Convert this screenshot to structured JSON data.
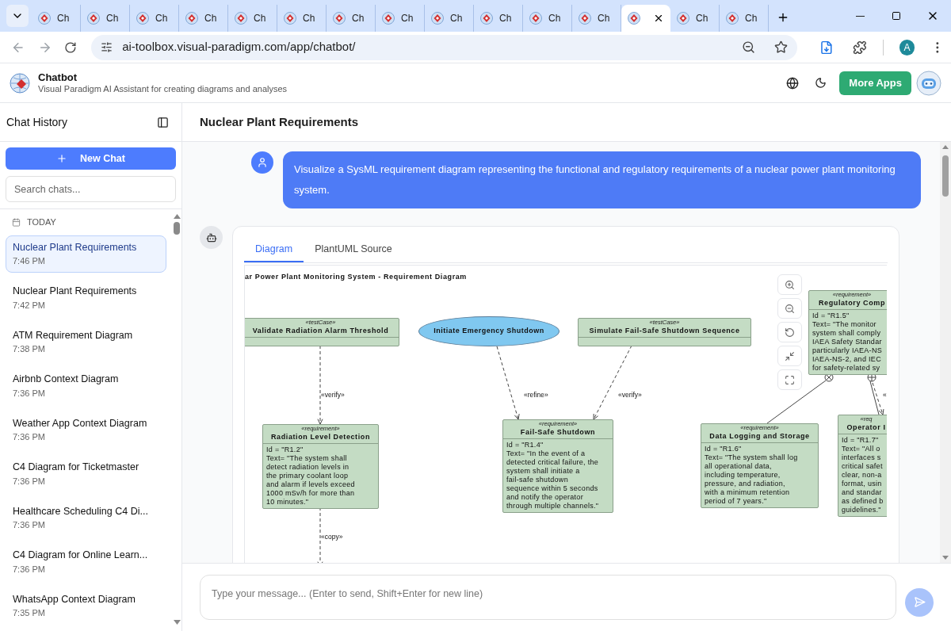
{
  "browser": {
    "tabs": [
      {
        "title": "Ch",
        "selected": false
      },
      {
        "title": "Ch",
        "selected": false
      },
      {
        "title": "Ch",
        "selected": false
      },
      {
        "title": "Ch",
        "selected": false
      },
      {
        "title": "Ch",
        "selected": false
      },
      {
        "title": "Ch",
        "selected": false
      },
      {
        "title": "Ch",
        "selected": false
      },
      {
        "title": "Ch",
        "selected": false
      },
      {
        "title": "Ch",
        "selected": false
      },
      {
        "title": "Ch",
        "selected": false
      },
      {
        "title": "Ch",
        "selected": false
      },
      {
        "title": "Ch",
        "selected": false
      },
      {
        "selected": true
      },
      {
        "title": "Ch",
        "selected": false
      },
      {
        "title": "Ch",
        "selected": false
      }
    ],
    "url": "ai-toolbox.visual-paradigm.com/app/chatbot/",
    "profile_initial": "A"
  },
  "app": {
    "title": "Chatbot",
    "subtitle": "Visual Paradigm AI Assistant for creating diagrams and analyses",
    "more_apps": "More Apps"
  },
  "sidebar": {
    "title": "Chat History",
    "new_chat": "New Chat",
    "search_placeholder": "Search chats...",
    "group": "TODAY",
    "items": [
      {
        "title": "Nuclear Plant Requirements",
        "time": "7:46 PM",
        "selected": true
      },
      {
        "title": "Nuclear Plant Requirements",
        "time": "7:42 PM",
        "selected": false
      },
      {
        "title": "ATM Requirement Diagram",
        "time": "7:38 PM",
        "selected": false
      },
      {
        "title": "Airbnb Context Diagram",
        "time": "7:36 PM",
        "selected": false
      },
      {
        "title": "Weather App Context Diagram",
        "time": "7:36 PM",
        "selected": false
      },
      {
        "title": "C4 Diagram for Ticketmaster",
        "time": "7:36 PM",
        "selected": false
      },
      {
        "title": "Healthcare Scheduling C4 Di...",
        "time": "7:36 PM",
        "selected": false
      },
      {
        "title": "C4 Diagram for Online Learn...",
        "time": "7:36 PM",
        "selected": false
      },
      {
        "title": "WhatsApp Context Diagram",
        "time": "7:35 PM",
        "selected": false
      }
    ]
  },
  "chat": {
    "title": "Nuclear Plant Requirements",
    "user_message": "Visualize a SysML requirement diagram representing the functional and regulatory requirements of a nuclear power plant monitoring system.",
    "result_tabs": [
      {
        "label": "Diagram",
        "selected": true
      },
      {
        "label": "PlantUML Source",
        "selected": false
      }
    ],
    "diagram": {
      "title": "ar Power Plant Monitoring System - Requirement Diagram",
      "nodes": [
        {
          "kind": "testcase",
          "stereotype": "«testCase»",
          "name": "Validate Radiation Alarm Threshold"
        },
        {
          "kind": "usecase",
          "name": "Initiate Emergency Shutdown"
        },
        {
          "kind": "testcase",
          "stereotype": "«testCase»",
          "name": "Simulate Fail-Safe Shutdown Sequence"
        },
        {
          "kind": "requirement",
          "stereotype": "«requirement»",
          "name": "Radiation Level Detection",
          "lines": [
            "Id = \"R1.2\"",
            "Text= \"The system shall",
            "detect radiation levels in",
            "the primary coolant loop",
            "and alarm if levels exceed",
            "1000 mSv/h for more than",
            "10 minutes.\""
          ]
        },
        {
          "kind": "requirement",
          "stereotype": "«requirement»",
          "name": "Fail-Safe Shutdown",
          "lines": [
            "Id = \"R1.4\"",
            "Text= \"In the event of a",
            "detected critical failure, the",
            "system shall initiate a",
            "fail-safe shutdown",
            "sequence within 5 seconds",
            "and notify the operator",
            "through multiple channels.\""
          ]
        },
        {
          "kind": "requirement",
          "stereotype": "«requirement»",
          "name": "Data Logging and Storage",
          "lines": [
            "Id = \"R1.6\"",
            "Text= \"The system shall log",
            "all operational data,",
            "including temperature,",
            "pressure, and radiation,",
            "with a minimum retention",
            "period of 7 years.\""
          ]
        },
        {
          "kind": "requirement",
          "stereotype": "«requirement»",
          "name": "Regulatory Comp",
          "lines": [
            "Id = \"R1.5\"",
            "Text= \"The monitor",
            "system shall comply",
            "IAEA Safety Standar",
            "particularly IAEA-NS",
            "IAEA-NS-2, and IEC",
            "for safety-related sy"
          ]
        },
        {
          "kind": "requirement",
          "stereotype": "«req",
          "name": "Operator I",
          "lines": [
            "Id = \"R1.7\"",
            "Text= \"All o",
            "interfaces s",
            "critical safet",
            "clear, non-a",
            "format, usin",
            "and standar",
            "as defined b",
            "guidelines.\""
          ]
        }
      ],
      "edge_labels": [
        "«verify»",
        "«copy»",
        "«refine»",
        "«verify»",
        "«"
      ]
    },
    "input_placeholder": "Type your message... (Enter to send, Shift+Enter for new line)"
  }
}
